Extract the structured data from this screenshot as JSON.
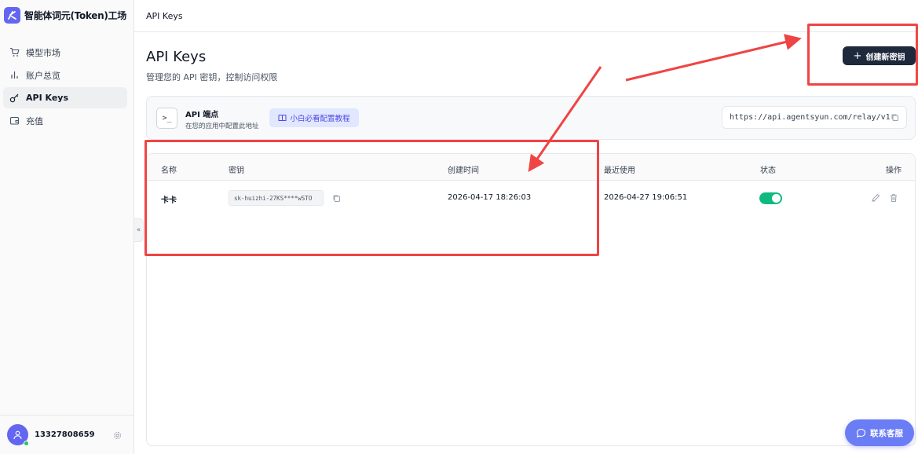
{
  "brand": {
    "name": "智能体词元(Token)工场"
  },
  "sidebar": {
    "items": [
      {
        "label": "模型市场",
        "icon": "cart-icon"
      },
      {
        "label": "账户总览",
        "icon": "bar-chart-icon"
      },
      {
        "label": "API Keys",
        "icon": "key-icon",
        "active": true
      },
      {
        "label": "充值",
        "icon": "wallet-icon"
      }
    ],
    "user": {
      "phone": "13327808659"
    }
  },
  "topbar": {
    "breadcrumb": "API Keys"
  },
  "header": {
    "title": "API Keys",
    "subtitle": "管理您的 API 密钥，控制访问权限",
    "create_label": "创建新密钥"
  },
  "endpoint": {
    "title": "API 端点",
    "desc": "在您的应用中配置此地址",
    "tutorial_label": "小白必看配置教程",
    "url": "https://api.agentsyun.com/relay/v1"
  },
  "table": {
    "headers": [
      "名称",
      "密钥",
      "创建时间",
      "最近使用",
      "状态",
      "操作"
    ],
    "rows": [
      {
        "name": "卡卡",
        "key": "sk-huizhi-27KS****wSTO",
        "created": "2026-04-17 18:26:03",
        "last_used": "2026-04-27 19:06:51",
        "enabled": true
      }
    ]
  },
  "support": {
    "label": "联系客服"
  },
  "colors": {
    "accent": "#6366f1",
    "toggle_on": "#10b981",
    "annotation": "#ef4444",
    "primary_btn": "#1e293b"
  }
}
